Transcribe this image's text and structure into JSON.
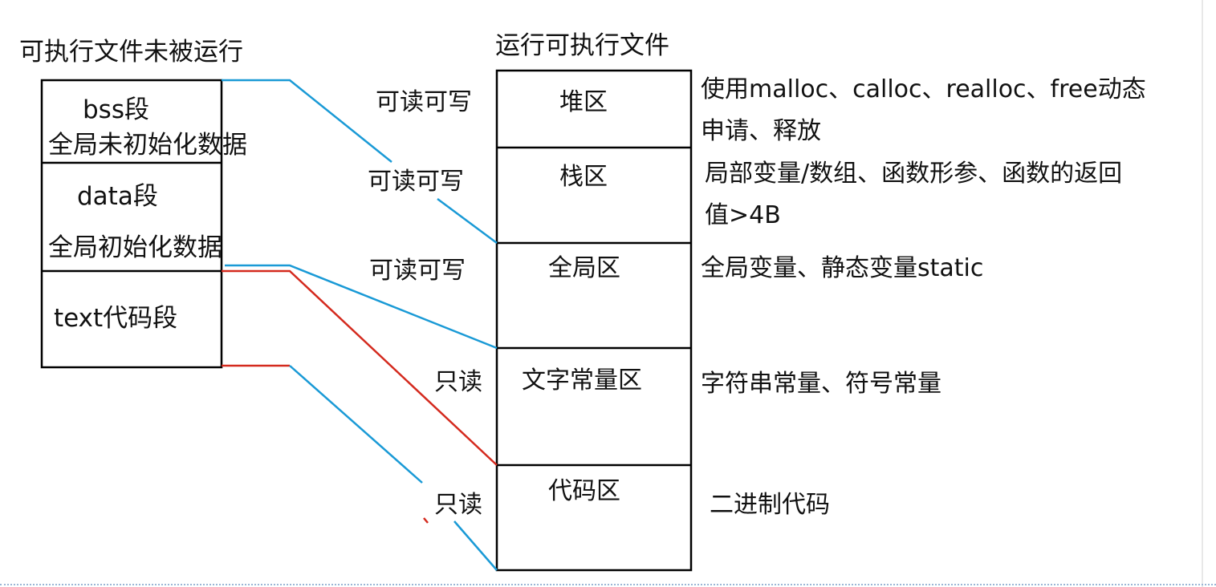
{
  "left": {
    "title": "可执行文件未被运行",
    "segments": {
      "bss_name": "bss段",
      "bss_desc": "全局未初始化数据",
      "data_name": "data段",
      "data_desc": "全局初始化数据",
      "text_name": "text代码段"
    }
  },
  "right": {
    "title": "运行可执行文件",
    "regions": [
      {
        "name": "堆区",
        "access": "可读可写",
        "desc": [
          "使用malloc、calloc、realloc、free动态",
          "申请、释放"
        ]
      },
      {
        "name": "栈区",
        "access": "可读可写",
        "desc": [
          "局部变量/数组、函数形参、函数的返回",
          "值>4B"
        ]
      },
      {
        "name": "全局区",
        "access": "可读可写",
        "desc": [
          "全局变量、静态变量static"
        ]
      },
      {
        "name": "文字常量区",
        "access": "只读",
        "desc": [
          "字符串常量、符号常量"
        ]
      },
      {
        "name": "代码区",
        "access": "只读",
        "desc": [
          "二进制代码"
        ]
      }
    ]
  },
  "colors": {
    "blue_connector": "#1a9ad6",
    "red_connector": "#d42a1e",
    "box_border": "#000000"
  }
}
